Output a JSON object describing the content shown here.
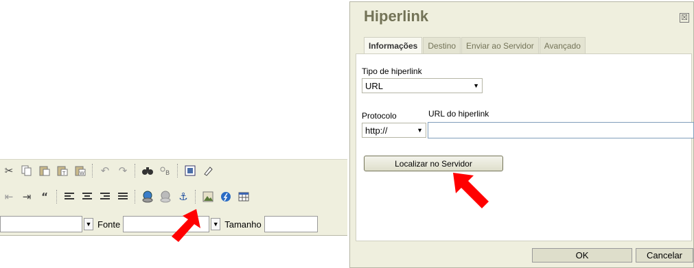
{
  "toolbar": {
    "row1_icons": [
      "cut-icon",
      "copy-icon",
      "paste-icon",
      "paste-text-icon",
      "paste-word-icon",
      "undo-icon",
      "redo-icon",
      "find-icon",
      "replace-icon",
      "select-all-icon",
      "remove-format-icon"
    ],
    "row2_icons": [
      "outdent-icon",
      "indent-icon",
      "blockquote-icon",
      "align-left-icon",
      "align-center-icon",
      "align-right-icon",
      "justify-icon",
      "link-icon",
      "unlink-icon",
      "anchor-icon",
      "image-icon",
      "flash-icon",
      "table-icon"
    ],
    "font_label": "Fonte",
    "size_label": "Tamanho",
    "font_value": "",
    "size_value": ""
  },
  "dialog": {
    "title": "Hiperlink",
    "close_glyph": "☒",
    "tabs": [
      {
        "label": "Informações",
        "active": true
      },
      {
        "label": "Destino",
        "active": false
      },
      {
        "label": "Enviar ao Servidor",
        "active": false
      },
      {
        "label": "Avançado",
        "active": false
      }
    ],
    "link_type_label": "Tipo de hiperlink",
    "link_type_value": "URL",
    "protocol_label": "Protocolo",
    "protocol_value": "http://",
    "url_label": "URL do hiperlink",
    "url_value": "",
    "browse_button": "Localizar no Servidor",
    "ok_button": "OK",
    "cancel_button": "Cancelar"
  },
  "colors": {
    "dialog_bg": "#efefde",
    "title_color": "#737357",
    "arrow_red": "#ff0000"
  }
}
